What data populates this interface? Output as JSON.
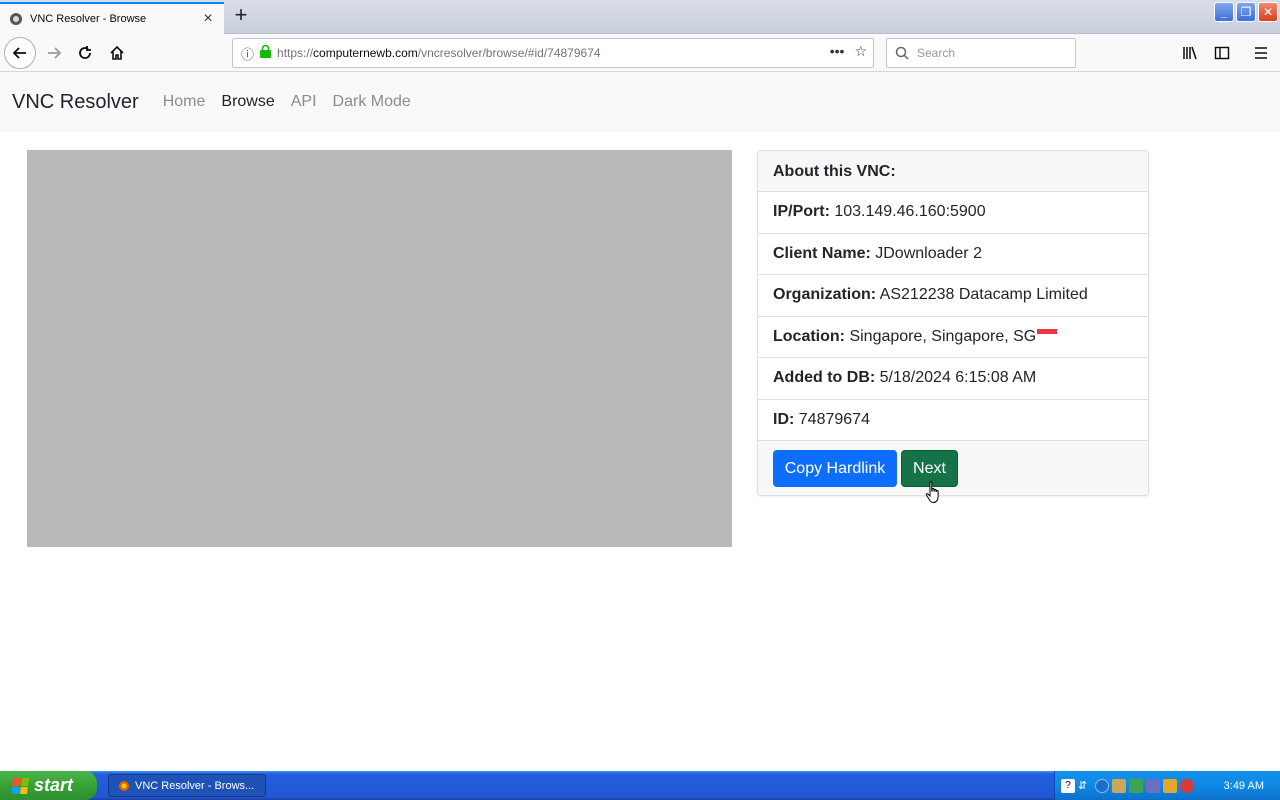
{
  "browser": {
    "tab_title": "VNC Resolver - Browse",
    "url_prefix": "https://",
    "url_domain": "computernewb.com",
    "url_path": "/vncresolver/browse/#id/74879674",
    "search_placeholder": "Search"
  },
  "site": {
    "brand": "VNC Resolver",
    "nav": [
      {
        "label": "Home"
      },
      {
        "label": "Browse"
      },
      {
        "label": "API"
      },
      {
        "label": "Dark Mode"
      }
    ]
  },
  "card": {
    "header": "About this VNC:",
    "rows": [
      {
        "label": "IP/Port:",
        "value": "103.149.46.160:5900"
      },
      {
        "label": "Client Name:",
        "value": "JDownloader 2"
      },
      {
        "label": "Organization:",
        "value": "AS212238 Datacamp Limited"
      },
      {
        "label": "Location:",
        "value": "Singapore, Singapore, SG"
      },
      {
        "label": "Added to DB:",
        "value": "5/18/2024 6:15:08 AM"
      },
      {
        "label": "ID:",
        "value": "74879674"
      }
    ],
    "buttons": {
      "copy": "Copy Hardlink",
      "next": "Next"
    }
  },
  "taskbar": {
    "start_label": "start",
    "task_label": "VNC Resolver - Brows...",
    "clock": "3:49 AM"
  },
  "colors": {
    "primary": "#0d6efd",
    "success": "#157347",
    "lock": "#12bc00"
  }
}
